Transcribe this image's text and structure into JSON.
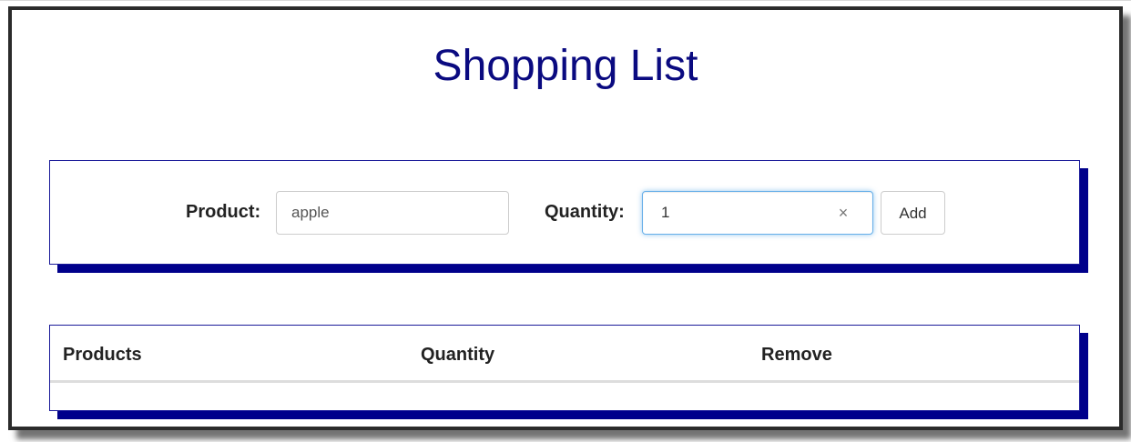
{
  "page": {
    "title": "Shopping List"
  },
  "form": {
    "product_label": "Product:",
    "product_value": "apple",
    "quantity_label": "Quantity:",
    "quantity_value": "1",
    "clear_glyph": "×",
    "add_label": "Add"
  },
  "table": {
    "columns": [
      "Products",
      "Quantity",
      "Remove"
    ],
    "rows": []
  },
  "colors": {
    "title": "#0a0a80",
    "panel_shadow": "#00008b",
    "panel_border": "#1a1a99",
    "focus_border": "#66afe9"
  },
  "icons": {
    "clear": "close-icon"
  }
}
